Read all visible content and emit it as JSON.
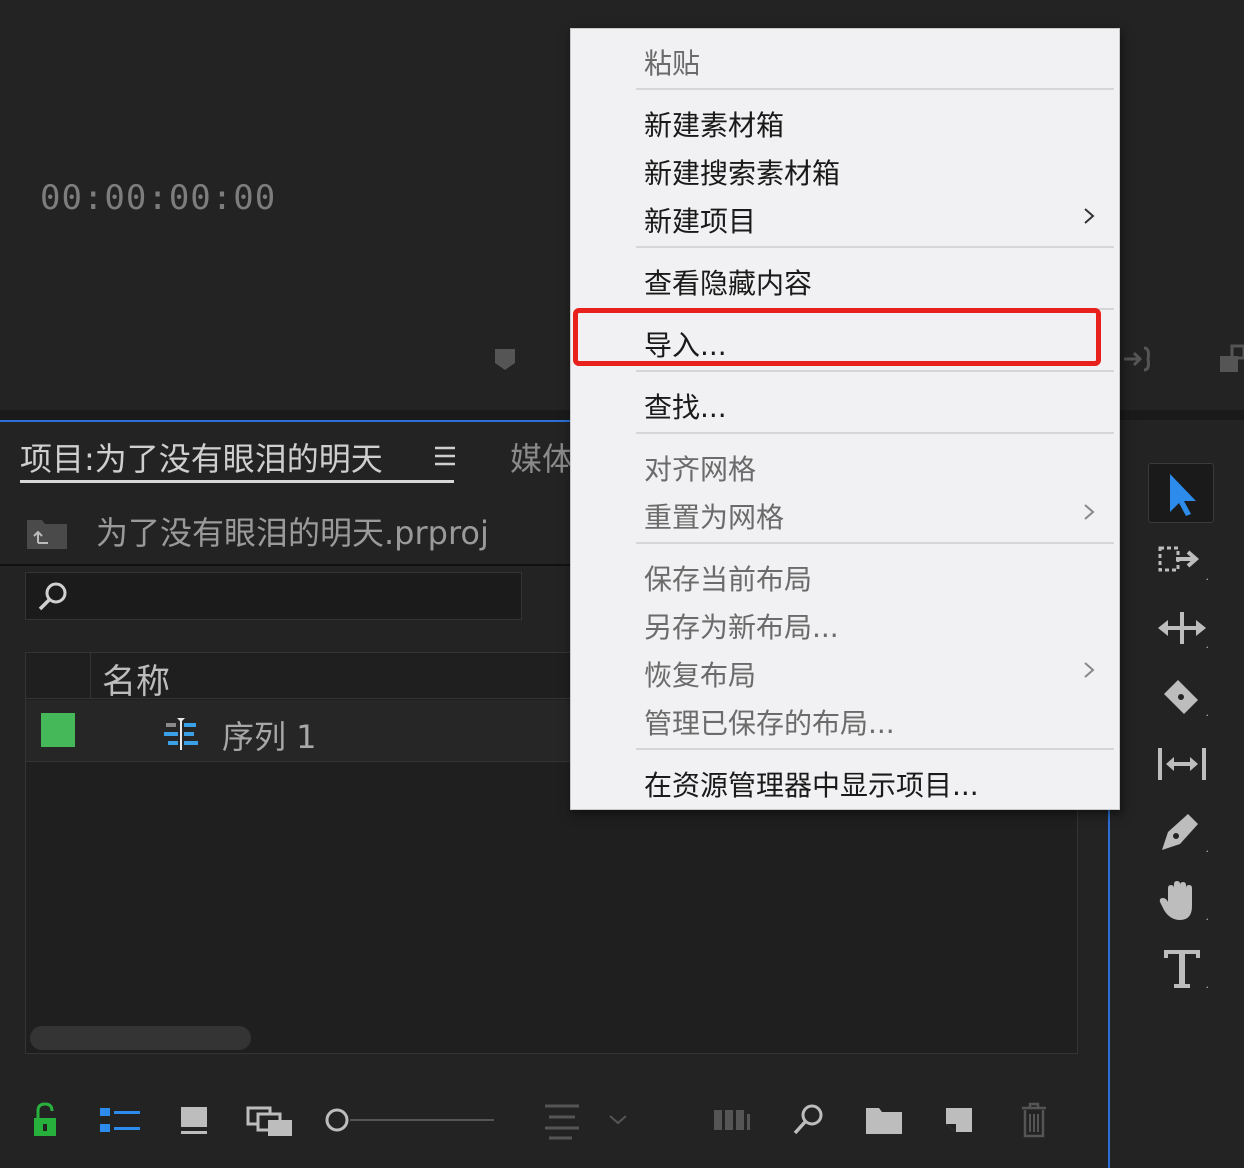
{
  "monitor": {
    "timecode": "00:00:00:00"
  },
  "project_panel": {
    "tab_label": "项目:为了没有眼泪的明天",
    "media_tab_label": "媒体",
    "project_file_name": "为了没有眼泪的明天.prproj",
    "search": {
      "value": "",
      "placeholder": ""
    },
    "columns": {
      "name": "名称"
    },
    "items": [
      {
        "name": "序列 1",
        "label_color": "#45b95a",
        "type_icon": "sequence-icon"
      }
    ]
  },
  "context_menu": {
    "items": [
      {
        "label": "粘贴",
        "enabled": false
      },
      {
        "label": "新建素材箱",
        "enabled": true
      },
      {
        "label": "新建搜索素材箱",
        "enabled": true
      },
      {
        "label": "新建项目",
        "enabled": true,
        "submenu": true
      },
      {
        "label": "查看隐藏内容",
        "enabled": true
      },
      {
        "label": "导入...",
        "enabled": true,
        "highlighted": true
      },
      {
        "label": "查找...",
        "enabled": true
      },
      {
        "label": "对齐网格",
        "enabled": false
      },
      {
        "label": "重置为网格",
        "enabled": false,
        "submenu": true
      },
      {
        "label": "保存当前布局",
        "enabled": false
      },
      {
        "label": "另存为新布局...",
        "enabled": false
      },
      {
        "label": "恢复布局",
        "enabled": false,
        "submenu": true
      },
      {
        "label": "管理已保存的布局...",
        "enabled": false
      },
      {
        "label": "在资源管理器中显示项目...",
        "enabled": true
      }
    ],
    "highlight_color": "#e8211c"
  },
  "right_tools": [
    "selection-tool-icon",
    "track-select-icon",
    "ripple-edit-icon",
    "razor-icon",
    "slip-icon",
    "pen-icon",
    "hand-icon",
    "type-icon"
  ],
  "bottom_toolbar": [
    "lock-icon",
    "list-view-icon",
    "icon-view-icon",
    "freeform-view-icon",
    "zoom-slider",
    "sort-icon",
    "automate-icon",
    "find-icon",
    "new-bin-icon",
    "new-item-icon",
    "clear-icon"
  ],
  "colors": {
    "accent": "#2b6fd6",
    "tool_active": "#2d8ceb"
  }
}
